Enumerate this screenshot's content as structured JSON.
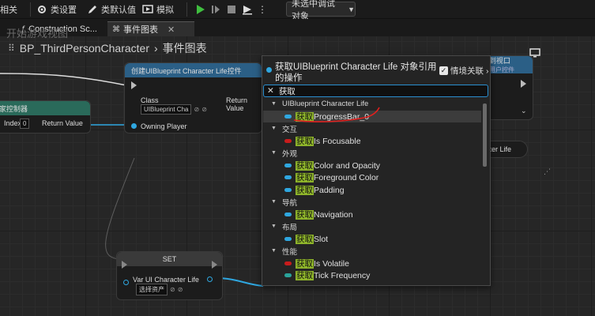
{
  "toolbar": {
    "partial_left": "相关",
    "class_settings": "类设置",
    "class_defaults": "类默认值",
    "simulate": "模拟",
    "debug_target": "未选中调试对象"
  },
  "tabs": [
    {
      "label": "Construction Sc..."
    },
    {
      "label": "事件图表"
    }
  ],
  "faded_title": "开始游戏视图",
  "breadcrumb": {
    "blueprint": "BP_ThirdPersonCharacter",
    "graph": "事件图表"
  },
  "nodes": {
    "create_widget": {
      "title": "创建UIBlueprint Character Life控件",
      "class_label": "Class",
      "class_value": "UIBlueprint Cha",
      "owning_player": "Owning Player",
      "return_value": "Return Value"
    },
    "player_controller": {
      "title": "家控制器",
      "index_label": "Index",
      "index_value": "0",
      "return_value": "Return Value"
    },
    "add_viewport": {
      "title": "到视口",
      "subtitle": "用户控件"
    },
    "right_ref": {
      "label": "cter Life"
    },
    "set_node": {
      "title": "SET",
      "var_label": "Var UI Character Life",
      "var_value": "选择资产"
    }
  },
  "menu": {
    "title": "获取UIBlueprint Character Life 对象引用的操作",
    "context_sensitive": "情境关联",
    "search_value": "获取",
    "categories": [
      {
        "label": "UIBlueprint Character Life",
        "items": [
          {
            "hl": "获取",
            "rest": "ProgressBar_0",
            "color": "#2fa7e0",
            "selected": true
          }
        ]
      },
      {
        "label": "交互",
        "items": [
          {
            "hl": "获取",
            "rest": "Is Focusable",
            "color": "#c81c1c"
          }
        ]
      },
      {
        "label": "外观",
        "items": [
          {
            "hl": "获取",
            "rest": "Color and Opacity",
            "color": "#2fa7e0"
          },
          {
            "hl": "获取",
            "rest": "Foreground Color",
            "color": "#2fa7e0"
          },
          {
            "hl": "获取",
            "rest": "Padding",
            "color": "#2fa7e0"
          }
        ]
      },
      {
        "label": "导航",
        "items": [
          {
            "hl": "获取",
            "rest": "Navigation",
            "color": "#2fa7e0"
          }
        ]
      },
      {
        "label": "布局",
        "items": [
          {
            "hl": "获取",
            "rest": "Slot",
            "color": "#2fa7e0"
          }
        ]
      },
      {
        "label": "性能",
        "items": [
          {
            "hl": "获取",
            "rest": "Is Volatile",
            "color": "#c81c1c"
          },
          {
            "hl": "获取",
            "rest": "Tick Frequency",
            "color": "#2aa39a"
          }
        ]
      }
    ]
  },
  "colors": {
    "accent_blue": "#2fa7e0",
    "highlight_green": "#8fb52a",
    "bool_red": "#c81c1c",
    "node_header_blue": "#2b5f86",
    "annotation_red": "#e0201e"
  }
}
